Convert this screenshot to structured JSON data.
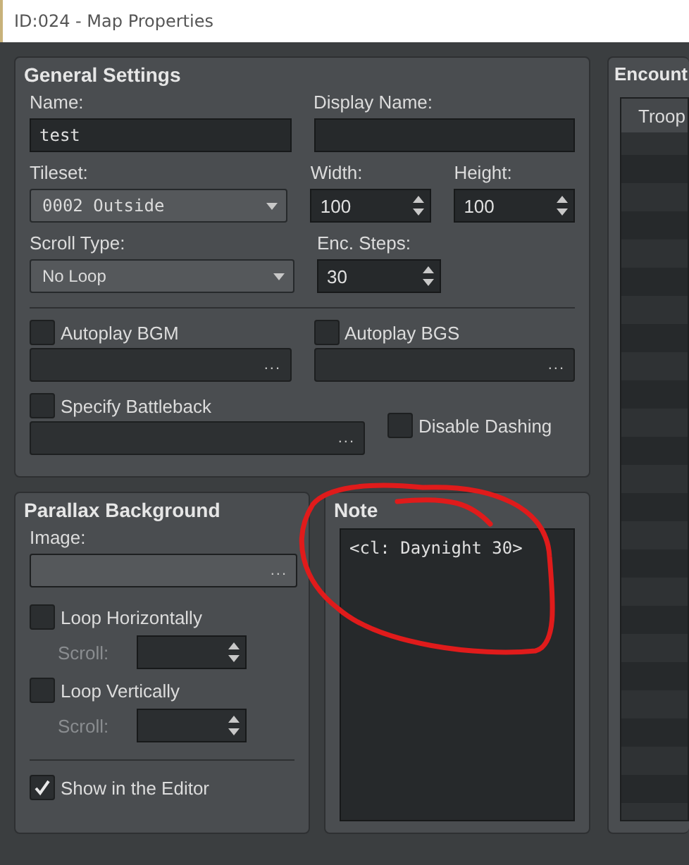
{
  "window": {
    "title": "ID:024 - Map Properties"
  },
  "general_settings": {
    "title": "General Settings",
    "name": {
      "label": "Name:",
      "value": "test"
    },
    "display_name": {
      "label": "Display Name:"
    },
    "tileset": {
      "label": "Tileset:",
      "value": "0002 Outside"
    },
    "width": {
      "label": "Width:",
      "value": "100"
    },
    "height": {
      "label": "Height:",
      "value": "100"
    },
    "scroll_type": {
      "label": "Scroll Type:",
      "value": "No Loop"
    },
    "enc_steps": {
      "label": "Enc. Steps:",
      "value": "30"
    },
    "autoplay_bgm": {
      "label": "Autoplay BGM",
      "checked": false,
      "button": "..."
    },
    "autoplay_bgs": {
      "label": "Autoplay BGS",
      "checked": false,
      "button": "..."
    },
    "specify_battleback": {
      "label": "Specify Battleback",
      "checked": false,
      "button": "..."
    },
    "disable_dashing": {
      "label": "Disable Dashing",
      "checked": false
    }
  },
  "parallax_background": {
    "title": "Parallax Background",
    "image": {
      "label": "Image:",
      "button": "..."
    },
    "loop_horizontally": {
      "label": "Loop Horizontally",
      "checked": false,
      "scroll_label": "Scroll:",
      "disabled": true
    },
    "loop_vertically": {
      "label": "Loop Vertically",
      "checked": false,
      "scroll_label": "Scroll:",
      "disabled": true
    },
    "show_in_editor": {
      "label": "Show in the Editor",
      "checked": true
    }
  },
  "note": {
    "title": "Note",
    "text": "<cl: Daynight 30>"
  },
  "encounters": {
    "title": "Encount",
    "column": "Troop"
  }
}
